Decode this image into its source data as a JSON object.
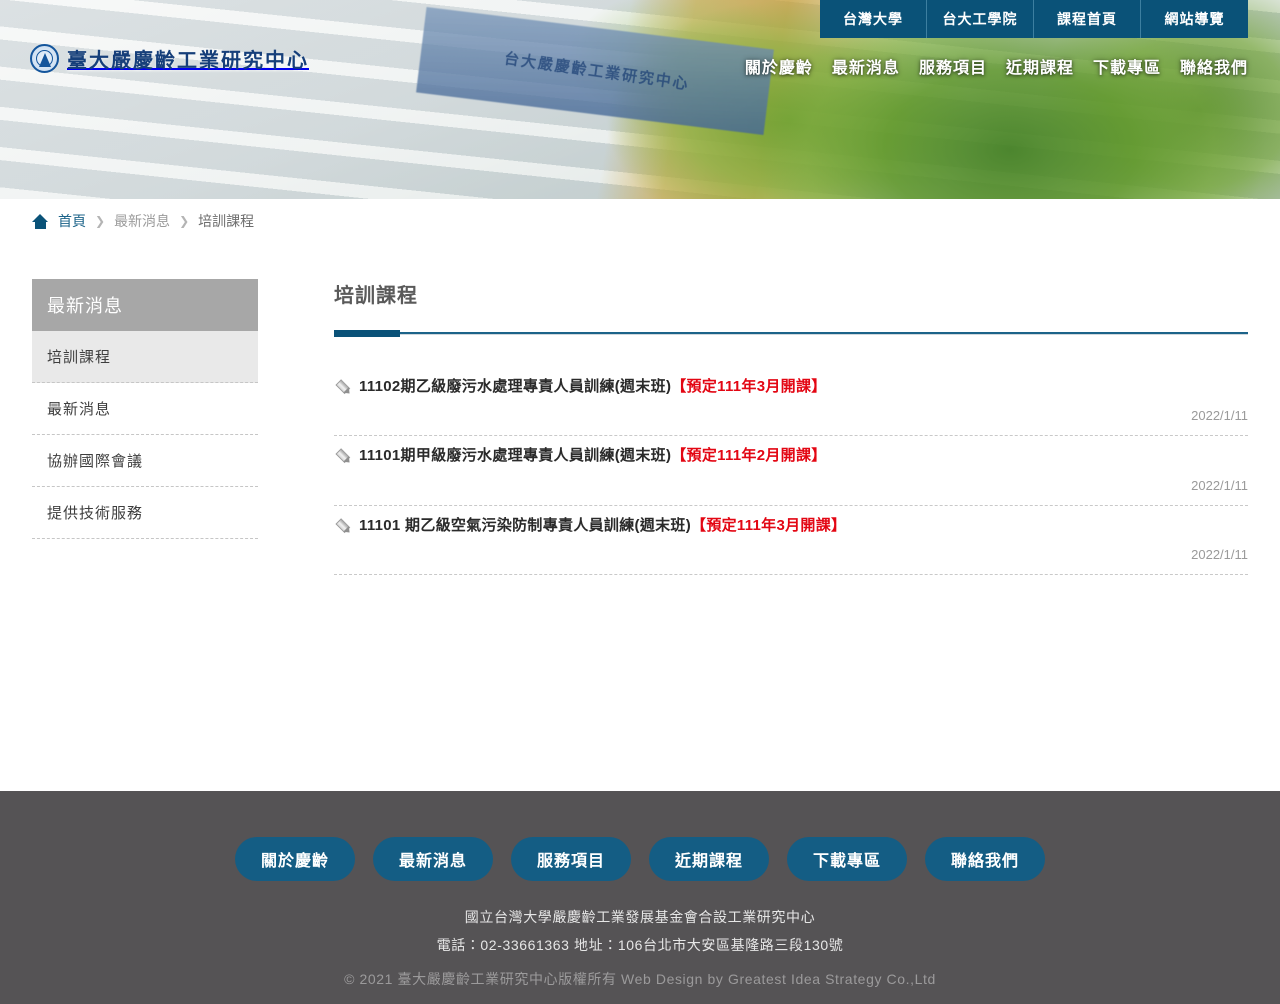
{
  "site": {
    "logo_text": "臺大嚴慶齡工業研究中心",
    "banner_sign_text": "台大嚴慶齡工業研究中心"
  },
  "topnav": [
    {
      "label": "台灣大學"
    },
    {
      "label": "台大工學院"
    },
    {
      "label": "課程首頁"
    },
    {
      "label": "網站導覽"
    }
  ],
  "mainnav": [
    {
      "label": "關於慶齡"
    },
    {
      "label": "最新消息"
    },
    {
      "label": "服務項目"
    },
    {
      "label": "近期課程"
    },
    {
      "label": "下載專區"
    },
    {
      "label": "聯絡我們"
    }
  ],
  "breadcrumb": {
    "home_label": "首頁",
    "sep": "❯",
    "mid_label": "最新消息",
    "current_label": "培訓課程"
  },
  "sidebar": {
    "header": "最新消息",
    "items": [
      {
        "label": "培訓課程",
        "active": true
      },
      {
        "label": "最新消息",
        "active": false
      },
      {
        "label": "協辦國際會議",
        "active": false
      },
      {
        "label": "提供技術服務",
        "active": false
      }
    ]
  },
  "content": {
    "title": "培訓課程",
    "news": [
      {
        "title_main": "11102期乙級廢污水處理專責人員訓練(週末班)",
        "title_highlight": "【預定111年3月開課】",
        "date": "2022/1/11"
      },
      {
        "title_main": "11101期甲級廢污水處理專責人員訓練(週末班)",
        "title_highlight": "【預定111年2月開課】",
        "date": "2022/1/11"
      },
      {
        "title_main": "11101 期乙級空氣污染防制專責人員訓練(週末班)",
        "title_highlight": "【預定111年3月開課】",
        "date": "2022/1/11"
      }
    ]
  },
  "footer": {
    "nav": [
      {
        "label": "關於慶齡"
      },
      {
        "label": "最新消息"
      },
      {
        "label": "服務項目"
      },
      {
        "label": "近期課程"
      },
      {
        "label": "下載專區"
      },
      {
        "label": "聯絡我們"
      }
    ],
    "org": "國立台灣大學嚴慶齡工業發展基金會合設工業研究中心",
    "contact": "電話：02-33661363 地址：106台北市大安區基隆路三段130號",
    "copyright": "© 2021 臺大嚴慶齡工業研究中心版權所有 Web Design by Greatest Idea Strategy Co.,Ltd"
  },
  "colors": {
    "accent_blue": "#0a5278",
    "link_blue": "#1c6389",
    "highlight_red": "#e30613",
    "sidebar_header_gray": "#a7a7a7",
    "footer_gray": "#555355",
    "footer_button_blue": "#145d84"
  }
}
